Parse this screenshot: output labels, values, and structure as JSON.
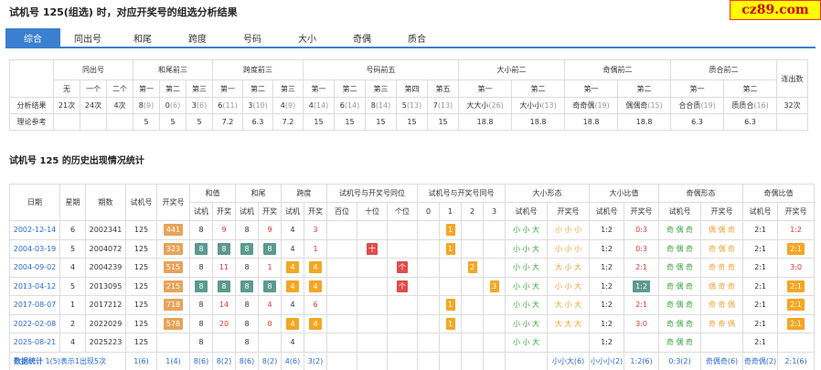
{
  "title": "试机号 125(组选) 时，对应开奖号的组选分析结果",
  "logo": "cz89.com",
  "tabs": [
    "综合",
    "同出号",
    "和尾",
    "跨度",
    "号码",
    "大小",
    "奇偶",
    "质合"
  ],
  "summary": {
    "groups": [
      "同出号",
      "和尾前三",
      "跨度前三",
      "号码前五",
      "大小前二",
      "奇偶前二",
      "质合前二",
      "连出数"
    ],
    "sub": [
      "无",
      "一个",
      "二个",
      "第一",
      "第二",
      "第三",
      "第一",
      "第二",
      "第三",
      "第一",
      "第二",
      "第三",
      "第四",
      "第五",
      "第一",
      "第二",
      "第一",
      "第二",
      "第一",
      "第二"
    ],
    "rows": [
      {
        "label": "分析结果",
        "cells": [
          {
            "v": "21次"
          },
          {
            "v": "24次"
          },
          {
            "v": "4次"
          },
          {
            "v": "8",
            "c": "(9)"
          },
          {
            "v": "0",
            "c": "(6)"
          },
          {
            "v": "3",
            "c": "(6)"
          },
          {
            "v": "6",
            "c": "(11)"
          },
          {
            "v": "3",
            "c": "(10)"
          },
          {
            "v": "4",
            "c": "(9)"
          },
          {
            "v": "4",
            "c": "(14)"
          },
          {
            "v": "6",
            "c": "(14)"
          },
          {
            "v": "8",
            "c": "(14)"
          },
          {
            "v": "5",
            "c": "(13)"
          },
          {
            "v": "7",
            "c": "(13)"
          },
          {
            "v": "大大小",
            "c": "(26)"
          },
          {
            "v": "大小小",
            "c": "(13)"
          },
          {
            "v": "奇奇偶",
            "c": "(19)"
          },
          {
            "v": "偶偶奇",
            "c": "(15)"
          },
          {
            "v": "合合质",
            "c": "(19)"
          },
          {
            "v": "质质合",
            "c": "(16)"
          },
          {
            "v": "32次"
          }
        ]
      },
      {
        "label": "理论参考",
        "cells": [
          {
            "v": ""
          },
          {
            "v": ""
          },
          {
            "v": ""
          },
          {
            "v": "5"
          },
          {
            "v": "5"
          },
          {
            "v": "5"
          },
          {
            "v": "7.2"
          },
          {
            "v": "6.3"
          },
          {
            "v": "7.2"
          },
          {
            "v": "15"
          },
          {
            "v": "15"
          },
          {
            "v": "15"
          },
          {
            "v": "15"
          },
          {
            "v": "15"
          },
          {
            "v": "18.8"
          },
          {
            "v": "18.8"
          },
          {
            "v": "18.8"
          },
          {
            "v": "18.8"
          },
          {
            "v": "6.3"
          },
          {
            "v": "6.3"
          },
          {
            "v": ""
          }
        ]
      }
    ]
  },
  "section2": "试机号 125 的历史出现情况统计",
  "history": {
    "groups": [
      "日期",
      "星期",
      "期数",
      "试机号",
      "开奖号",
      "和值",
      "和尾",
      "跨度",
      "试机号与开奖号同位",
      "试机号与开奖号同号",
      "大小形态",
      "大小比值",
      "奇偶形态",
      "奇偶比值"
    ],
    "sub": [
      "试机",
      "开奖",
      "试机",
      "开奖",
      "试机",
      "开奖",
      "百位",
      "十位",
      "个位",
      "0",
      "1",
      "2",
      "3",
      "试机号",
      "开奖号",
      "试机号",
      "开奖号",
      "试机号",
      "开奖号",
      "试机号",
      "开奖号"
    ],
    "rows": [
      [
        "2002-12-14",
        "6",
        "2002341",
        "125",
        "441",
        "8",
        "9",
        "8",
        "9",
        "4",
        "3",
        "",
        "",
        "",
        "",
        "1",
        "",
        "",
        "小 小 大",
        "小 小 小",
        "1:2",
        "0:3",
        "奇 偶 奇",
        "偶 偶 奇",
        "2:1",
        "1:2"
      ],
      [
        "2004-03-19",
        "5",
        "2004072",
        "125",
        "323",
        "8",
        "8",
        "8",
        "8",
        "4",
        "1",
        "",
        "十",
        "",
        "",
        "1",
        "",
        "",
        "小 小 大",
        "小 小 小",
        "1:2",
        "0:3",
        "奇 偶 奇",
        "奇 偶 奇",
        "2:1",
        "2:1"
      ],
      [
        "2004-09-02",
        "4",
        "2004239",
        "125",
        "515",
        "8",
        "11",
        "8",
        "1",
        "4",
        "4",
        "",
        "",
        "个",
        "",
        "",
        "2",
        "",
        "小 小 大",
        "大 小 大",
        "1:2",
        "2:1",
        "奇 偶 奇",
        "奇 奇 奇",
        "2:1",
        "3:0"
      ],
      [
        "2013-04-12",
        "5",
        "2013095",
        "125",
        "215",
        "8",
        "8",
        "8",
        "8",
        "4",
        "4",
        "",
        "",
        "个",
        "",
        "",
        "",
        "3",
        "小 小 大",
        "小 小 大",
        "1:2",
        "1:2",
        "奇 偶 奇",
        "偶 奇 奇",
        "2:1",
        "2:1"
      ],
      [
        "2017-08-07",
        "1",
        "2017212",
        "125",
        "718",
        "8",
        "14",
        "8",
        "4",
        "4",
        "6",
        "",
        "",
        "",
        "",
        "1",
        "",
        "",
        "小 小 大",
        "大 小 大",
        "1:2",
        "2:1",
        "奇 偶 奇",
        "奇 奇 偶",
        "2:1",
        "2:1"
      ],
      [
        "2022-02-08",
        "2",
        "2022029",
        "125",
        "578",
        "8",
        "20",
        "8",
        "0",
        "4",
        "4",
        "",
        "",
        "",
        "",
        "1",
        "",
        "",
        "小 小 大",
        "大 大 大",
        "1:2",
        "3:0",
        "奇 偶 奇",
        "奇 奇 偶",
        "2:1",
        "2:1"
      ],
      [
        "2025-08-21",
        "4",
        "2025223",
        "125",
        "",
        "8",
        "",
        "8",
        "",
        "4",
        "",
        "",
        "",
        "",
        "",
        "",
        "",
        "",
        "小 小 大",
        "",
        "1:2",
        "",
        "奇 偶 奇",
        "",
        "2:1",
        ""
      ]
    ],
    "footer": [
      "数据统计",
      "1(5)表示1出现5次",
      "1(6)",
      "1(4)",
      "8(6)",
      "8(2)",
      "8(6)",
      "8(2)",
      "4(6)",
      "3(2)",
      "",
      "",
      "",
      "",
      "",
      "",
      "",
      "",
      "小小大(6)",
      "小小小(2)",
      "1:2(6)",
      "0:3(2)",
      "奇偶奇(6)",
      "奇奇偶(2)",
      "2:1(6)",
      "2:1(4)"
    ]
  },
  "colors": {
    "tab_active": "#3b7fd0",
    "box_orange": "#f5a623",
    "box_red": "#e04b4b",
    "box_teal": "#5b9a8f"
  }
}
